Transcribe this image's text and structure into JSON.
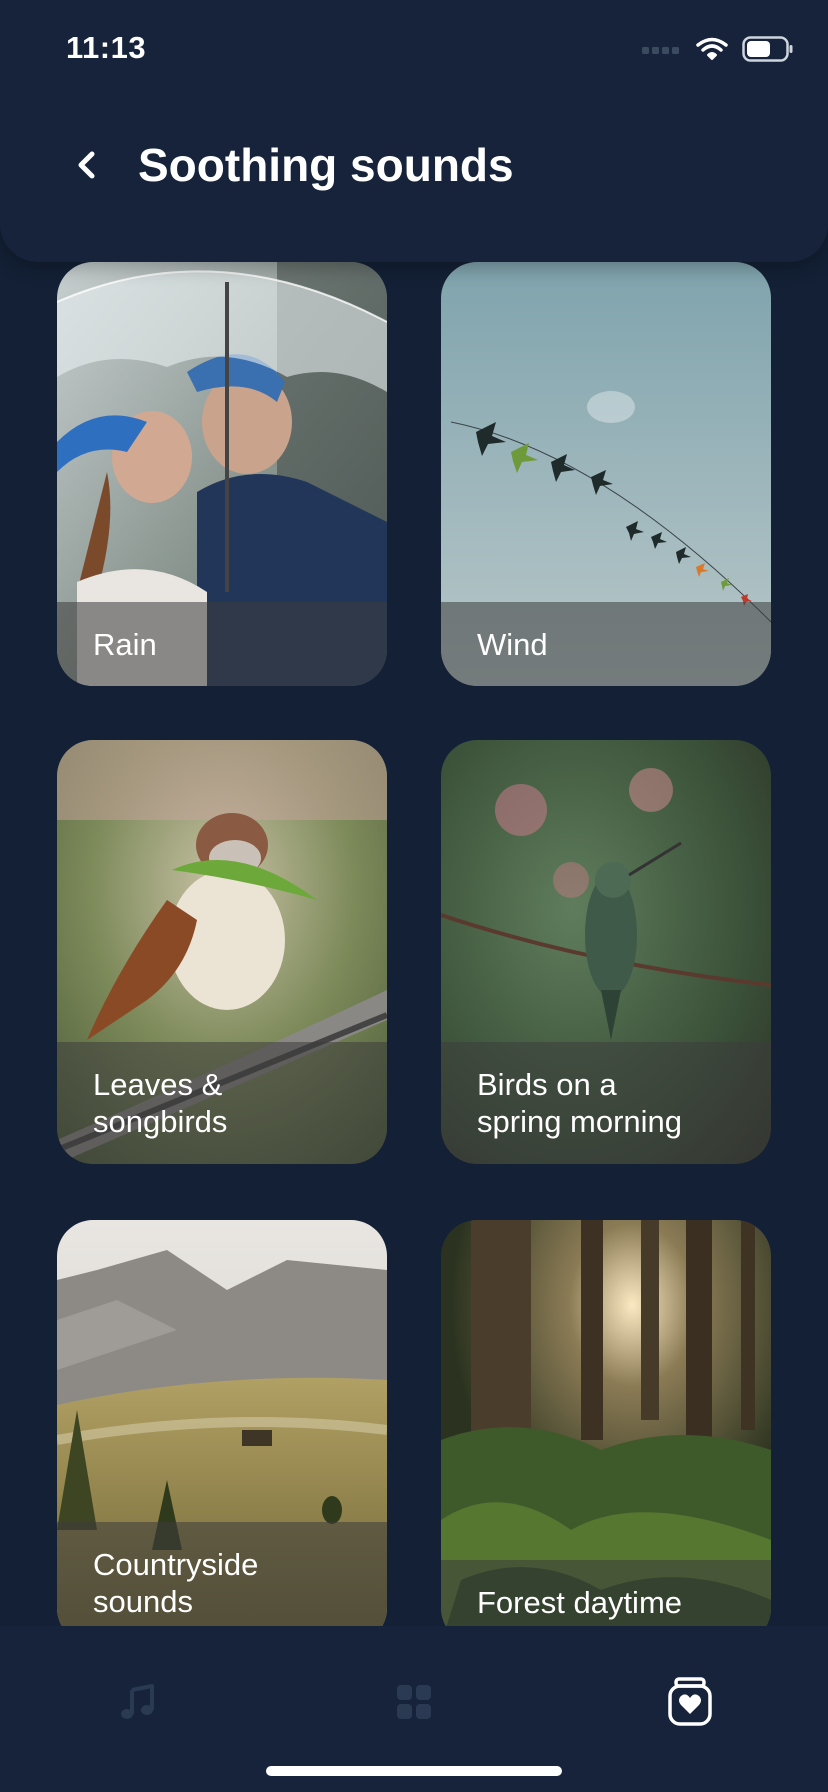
{
  "status": {
    "time": "11:13"
  },
  "header": {
    "title": "Soothing sounds"
  },
  "cards": [
    {
      "label": "Rain"
    },
    {
      "label": "Wind"
    },
    {
      "label": "Leaves &\nsongbirds"
    },
    {
      "label": "Birds on a\nspring morning"
    },
    {
      "label": "Countryside\nsounds"
    },
    {
      "label": "Forest daytime"
    }
  ],
  "nav": {
    "items": [
      "music-note-icon",
      "grid-icon",
      "heart-jar-icon"
    ],
    "active": "heart-jar-icon"
  },
  "colors": {
    "background": "#132035",
    "header": "#16233a",
    "label_overlay": "rgba(60,60,60,0.55)",
    "nav_inactive": "#2a3a52",
    "nav_active": "#ffffff"
  }
}
